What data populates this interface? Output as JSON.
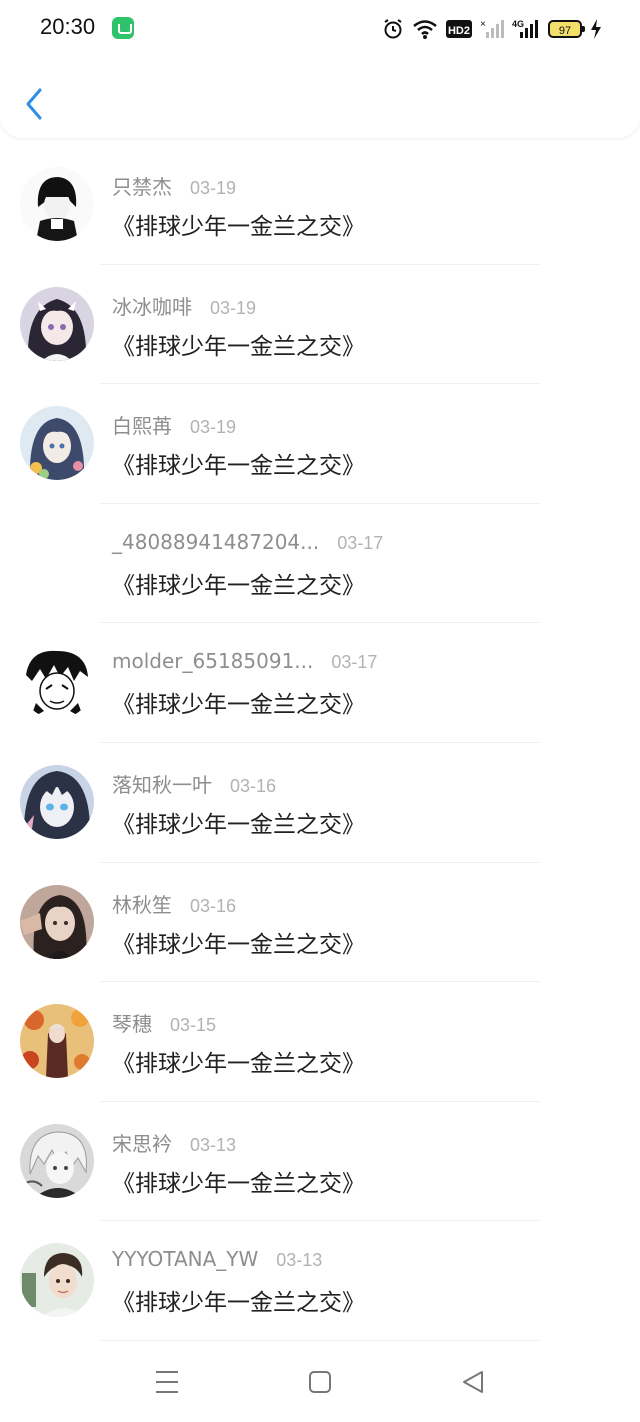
{
  "status_bar": {
    "time": "20:30",
    "battery": "97",
    "network": "4G"
  },
  "message_text": "《排球少年一金兰之交》",
  "rows": [
    {
      "name": "只禁杰",
      "date": "03-19",
      "message": "《排球少年一金兰之交》",
      "avatar": "dark-boy-avatar"
    },
    {
      "name": "冰冰咖啡",
      "date": "03-19",
      "message": "《排球少年一金兰之交》",
      "avatar": "maid-girl-avatar"
    },
    {
      "name": "白熙苒",
      "date": "03-19",
      "message": "《排球少年一金兰之交》",
      "avatar": "anime-girl-blue-avatar"
    },
    {
      "name": "_48088941487204...",
      "date": "03-17",
      "message": "《排球少年一金兰之交》",
      "avatar": "empty-avatar"
    },
    {
      "name": "molder_65185091...",
      "date": "03-17",
      "message": "《排球少年一金兰之交》",
      "avatar": "manga-avatar"
    },
    {
      "name": "落知秋一叶",
      "date": "03-16",
      "message": "《排球少年一金兰之交》",
      "avatar": "blue-eyes-avatar"
    },
    {
      "name": "林秋笙",
      "date": "03-16",
      "message": "《排球少年一金兰之交》",
      "avatar": "photo-girl-avatar"
    },
    {
      "name": "琴穗",
      "date": "03-15",
      "message": "《排球少年一金兰之交》",
      "avatar": "autumn-avatar"
    },
    {
      "name": "宋思衿",
      "date": "03-13",
      "message": "《排球少年一金兰之交》",
      "avatar": "white-hair-avatar"
    },
    {
      "name": "YYYOTANA_YW",
      "date": "03-13",
      "message": "《排球少年一金兰之交》",
      "avatar": "photo-boy-avatar"
    }
  ],
  "colors": {
    "accent": "#2f8fe8",
    "name_text": "#8e8e8e",
    "date_text": "#b2b2b2",
    "message_text": "#222222"
  }
}
